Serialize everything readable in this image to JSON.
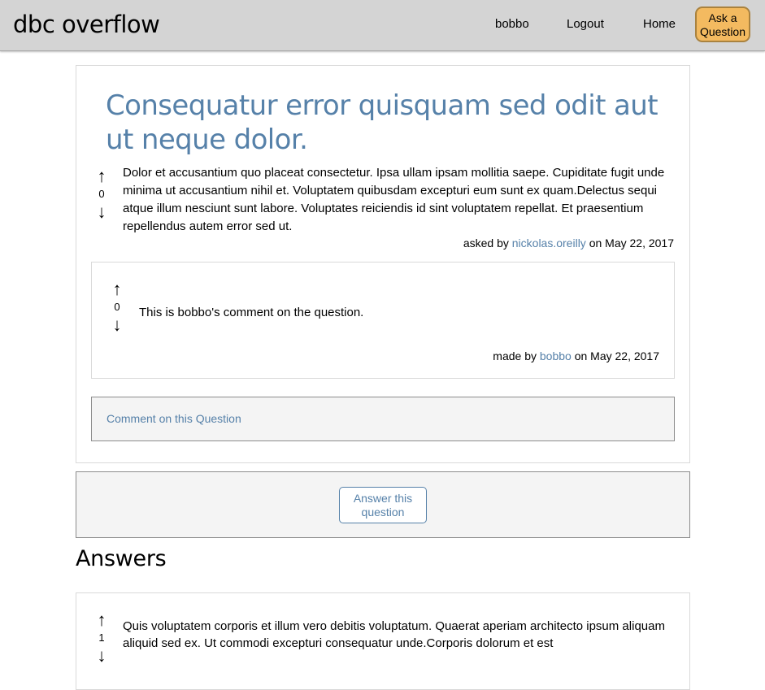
{
  "header": {
    "brand": "dbc overflow",
    "nav": {
      "user": "bobbo",
      "logout": "Logout",
      "home": "Home"
    },
    "ask_button": "Ask a Question"
  },
  "question": {
    "title": "Consequatur error quisquam sed odit aut ut neque dolor.",
    "votes": "0",
    "body": "Dolor et accusantium quo placeat consectetur. Ipsa ullam ipsam mollitia saepe. Cupiditate fugit unde minima ut accusantium nihil et. Voluptatem quibusdam excepturi eum sunt ex quam.Delectus sequi atque illum nesciunt sunt labore. Voluptates reiciendis id sint voluptatem repellat. Et praesentium repellendus autem error sed ut.",
    "asked_prefix": "asked by",
    "author": "nickolas.oreilly",
    "date": "on May 22, 2017"
  },
  "comment": {
    "votes": "0",
    "body": "This is bobbo's comment on the question.",
    "made_prefix": "made by",
    "author": "bobbo",
    "date": "on May 22, 2017"
  },
  "comment_link": "Comment on this Question",
  "answer_button": "Answer this question",
  "answers_heading": "Answers",
  "answers": [
    {
      "votes": "1",
      "body": "Quis voluptatem corporis et illum vero debitis voluptatum. Quaerat aperiam architecto ipsum aliquam aliquid sed ex. Ut commodi excepturi consequatur unde.Corporis dolorum et est"
    }
  ],
  "icons": {
    "up": "arrow-up-icon",
    "down": "arrow-down-icon"
  },
  "colors": {
    "link": "#5681a9",
    "ask_button": "#f3ba60",
    "header_bg": "#d4d4d4"
  }
}
